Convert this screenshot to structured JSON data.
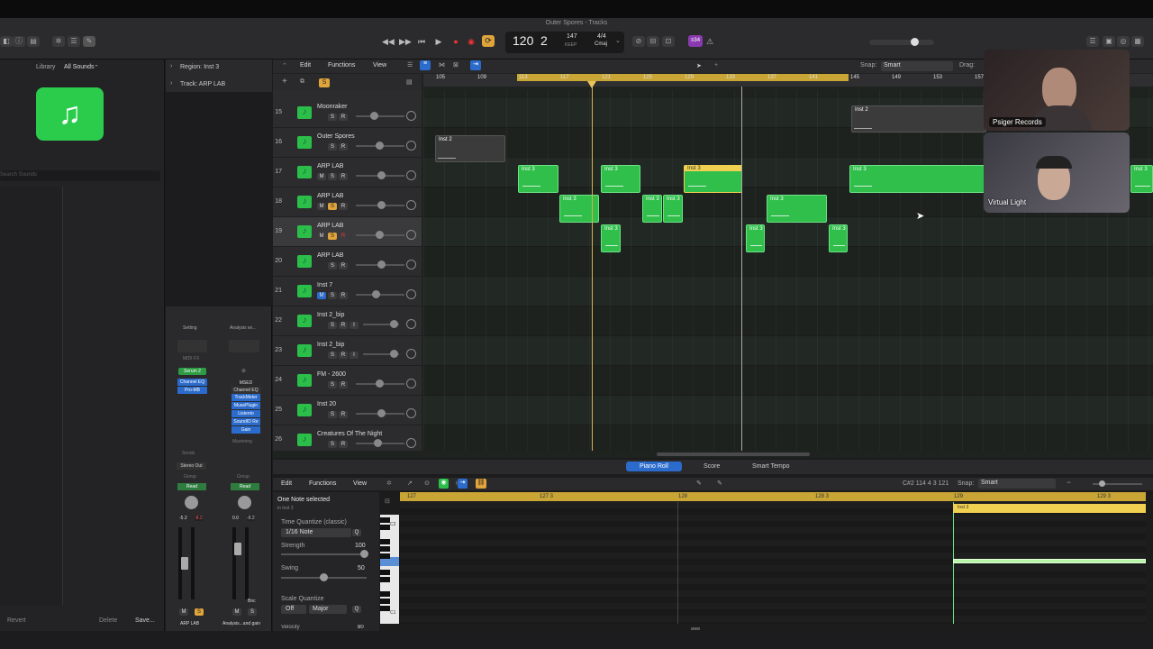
{
  "window": {
    "title": "Outer Spores - Tracks"
  },
  "lcd": {
    "tempo": "120",
    "bar": "2",
    "keep": "147",
    "keep_label": "KEEP",
    "sig": "4/4",
    "key": "Cmaj"
  },
  "library": {
    "label": "Library",
    "selector": "All Sounds",
    "search_placeholder": "Search Sounds",
    "revert": "Revert",
    "delete": "Delete",
    "save": "Save..."
  },
  "inspector": {
    "region": "Region: Inst 3",
    "track": "Track: ARP LAB"
  },
  "mixer": {
    "strip1": {
      "setting": "Setting",
      "midifx": "MIDI FX",
      "inst": "Serum 2",
      "fx": [
        "Channel EQ",
        "Pro-MB"
      ],
      "sends": "Sends",
      "out": "Stereo Out",
      "group": "Group",
      "read": "Read",
      "vol": "-5.2",
      "peak": "-8.2",
      "m": "M",
      "s": "S",
      "name": "ARP LAB"
    },
    "strip2": {
      "setting": "Analysis wi...",
      "fx": [
        "MSED",
        "Channel EQ",
        "TrackMeter",
        "MusePlugin",
        "Listento",
        "SoundID Re",
        "Gain"
      ],
      "group": "Group",
      "read": "Read",
      "vol": "0.0",
      "peak": "-9.2",
      "bnc": "Bnc",
      "m": "M",
      "s": "S",
      "name": "Analysis...and gain",
      "mastering": "Mastering"
    }
  },
  "tracks_toolbar": {
    "edit": "Edit",
    "functions": "Functions",
    "view": "View",
    "snap_label": "Snap:",
    "snap": "Smart",
    "drag_label": "Drag:",
    "s_btn": "S"
  },
  "ruler": [
    "105",
    "109",
    "113",
    "117",
    "121",
    "125",
    "129",
    "133",
    "137",
    "141",
    "145",
    "149",
    "153",
    "157",
    "17"
  ],
  "tracks": [
    {
      "num": "15",
      "name": "Moonraker"
    },
    {
      "num": "16",
      "name": "Outer Spores"
    },
    {
      "num": "17",
      "name": "ARP LAB"
    },
    {
      "num": "18",
      "name": "ARP LAB"
    },
    {
      "num": "19",
      "name": "ARP LAB"
    },
    {
      "num": "20",
      "name": "ARP LAB"
    },
    {
      "num": "21",
      "name": "Inst 7"
    },
    {
      "num": "22",
      "name": "Inst 2_bip"
    },
    {
      "num": "23",
      "name": "Inst 2_bip"
    },
    {
      "num": "24",
      "name": "FM - 2600"
    },
    {
      "num": "25",
      "name": "Inst 20"
    },
    {
      "num": "26",
      "name": "Creatures Of The Night"
    }
  ],
  "regions": {
    "inst2": "Inst 2",
    "inst3": "Inst 3"
  },
  "bottom": {
    "tab_pianoroll": "Piano Roll",
    "tab_score": "Score",
    "tab_smart": "Smart Tempo",
    "edit": "Edit",
    "functions": "Functions",
    "view": "View",
    "info": "C#2  114 4 3 121",
    "snap_label": "Snap:",
    "snap": "Smart",
    "selected": "One Note selected",
    "sub": "in Inst 3",
    "tq": "Time Quantize (classic)",
    "note": "1/16 Note",
    "q": "Q",
    "strength": "Strength",
    "strength_val": "100",
    "swing": "Swing",
    "swing_val": "50",
    "sq": "Scale Quantize",
    "off": "Off",
    "major": "Major",
    "velocity": "Velocity",
    "vel_val": "80",
    "ruler": [
      "127",
      "127 3",
      "128",
      "128 3",
      "129",
      "129 3"
    ],
    "c2": "C2",
    "c1": "C1",
    "region": "Inst 3"
  },
  "cams": {
    "top": "Psiger Records",
    "bottom": "Virtual Light"
  }
}
